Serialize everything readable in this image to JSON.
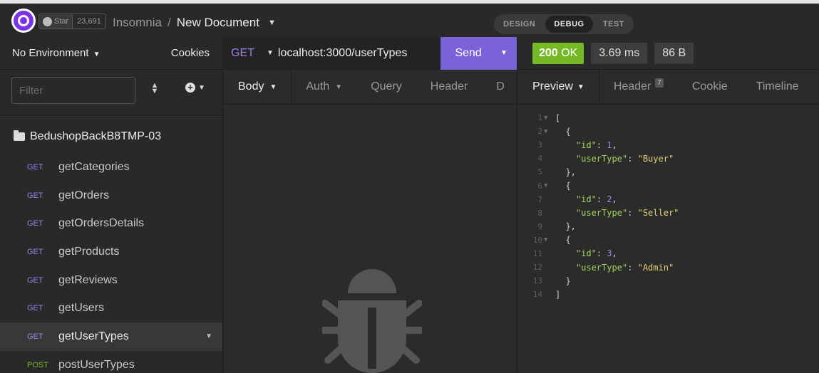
{
  "app": {
    "github_star_label": "Star",
    "github_star_count": "23,691",
    "breadcrumb_root": "Insomnia",
    "breadcrumb_separator": "/",
    "document_name": "New Document",
    "modes": [
      "DESIGN",
      "DEBUG",
      "TEST"
    ],
    "active_mode": "DEBUG"
  },
  "sidebar": {
    "environment": "No Environment",
    "cookies": "Cookies",
    "filter_placeholder": "Filter",
    "folder_name": "BedushopBackB8TMP-03",
    "requests": [
      {
        "method": "GET",
        "name": "getCategories",
        "active": false
      },
      {
        "method": "GET",
        "name": "getOrders",
        "active": false
      },
      {
        "method": "GET",
        "name": "getOrdersDetails",
        "active": false
      },
      {
        "method": "GET",
        "name": "getProducts",
        "active": false
      },
      {
        "method": "GET",
        "name": "getReviews",
        "active": false
      },
      {
        "method": "GET",
        "name": "getUsers",
        "active": false
      },
      {
        "method": "GET",
        "name": "getUserTypes",
        "active": true
      },
      {
        "method": "POST",
        "name": "postUserTypes",
        "active": false
      }
    ]
  },
  "request": {
    "method": "GET",
    "url": "localhost:3000/userTypes",
    "send_label": "Send",
    "tabs": [
      "Body",
      "Auth",
      "Query",
      "Header",
      "D"
    ]
  },
  "response": {
    "status": "200",
    "status_text": "OK",
    "time": "3.69 ms",
    "size": "86 B",
    "tabs": [
      "Preview",
      "Header",
      "Cookie",
      "Timeline"
    ],
    "header_count": "7",
    "lines": [
      "[",
      "  {",
      "    \"id\": 1,",
      "    \"userType\": \"Buyer\"",
      "  },",
      "  {",
      "    \"id\": 2,",
      "    \"userType\": \"Seller\"",
      "  },",
      "  {",
      "    \"id\": 3,",
      "    \"userType\": \"Admin\"",
      "  }",
      "]"
    ]
  },
  "colors": {
    "accent": "#7b62d8",
    "get_method": "#9e80e8",
    "post_method": "#75ba24",
    "status_ok": "#75ba24"
  }
}
